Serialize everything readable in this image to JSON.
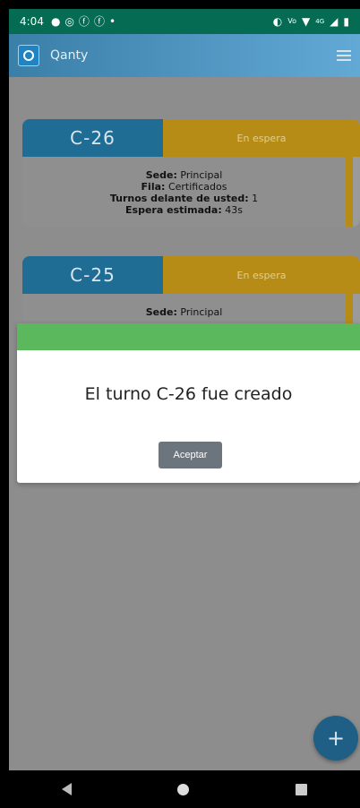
{
  "status_bar": {
    "time": "4:04",
    "left_icons": [
      "chat-icon",
      "whatsapp-icon",
      "facebook-icon",
      "facebook-icon",
      "dot-icon"
    ],
    "right_icons": [
      "vibrate-icon",
      "volte-icon",
      "wifi-icon",
      "4g-icon",
      "signal-icon",
      "battery-icon"
    ]
  },
  "app_bar": {
    "title": "Qanty"
  },
  "tickets": [
    {
      "code": "C-26",
      "status": "En espera",
      "sede_label": "Sede:",
      "sede_value": "Principal",
      "fila_label": "Fila:",
      "fila_value": "Certificados",
      "turnos_label": "Turnos delante de usted:",
      "turnos_value": "1",
      "espera_label": "Espera estimada:",
      "espera_value": "43s"
    },
    {
      "code": "C-25",
      "status": "En espera",
      "sede_label": "Sede:",
      "sede_value": "Principal"
    }
  ],
  "dialog": {
    "message": "El turno C-26 fue creado",
    "accept_label": "Aceptar"
  },
  "fab": {
    "label": "+"
  },
  "colors": {
    "success": "#5cb85c",
    "ticket_code_bg": "#1f6d95",
    "ticket_status_bg": "#b68b16",
    "button_secondary": "#6c757d"
  }
}
